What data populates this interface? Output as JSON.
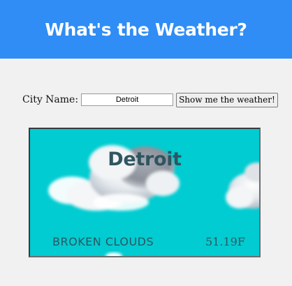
{
  "header": {
    "title": "What's the Weather?"
  },
  "form": {
    "city_label": "City Name:",
    "city_value": "Detroit",
    "button_label": "Show me the weather!"
  },
  "weather": {
    "city": "Detroit",
    "condition": "BROKEN CLOUDS",
    "temperature": "51.19F",
    "background_color": "#00ccd1",
    "icon": "clouds-icon"
  },
  "colors": {
    "header": "#2f8df5",
    "card_text": "#2f5560"
  }
}
